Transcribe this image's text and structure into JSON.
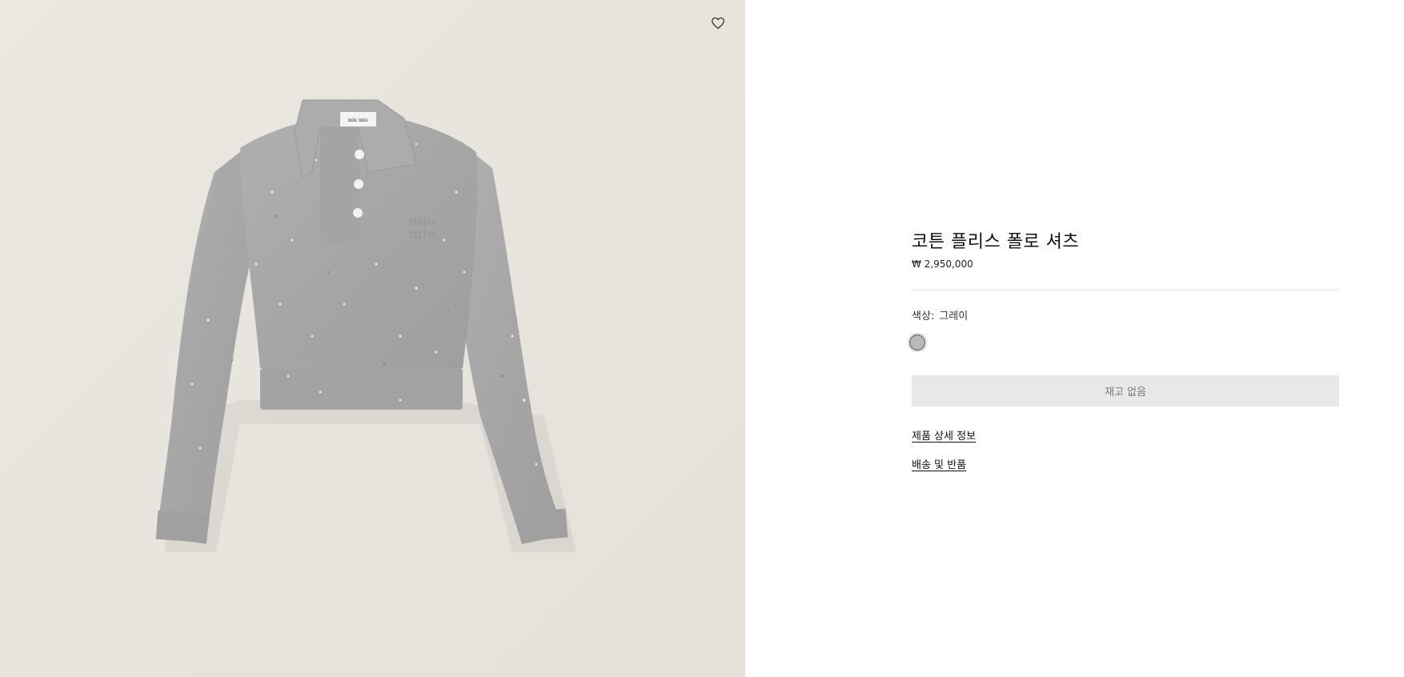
{
  "product": {
    "title": "코튼 플리스 폴로 셔츠",
    "price": "₩ 2,950,000",
    "color_label": "색상:",
    "color_value": "그레이",
    "swatch_color": "#b8b8b8",
    "stock_button_label": "재고 없음",
    "details_link": "제품 상세 정보",
    "shipping_link": "배송 및 반품",
    "image_alt_icon": "cropped-polo-sweatshirt-image",
    "garment_brand_label": "miu miu"
  },
  "icons": {
    "wishlist": "heart-icon"
  },
  "colors": {
    "image_background": "#e8e4de",
    "garment": "#a9a9a9",
    "disabled_button_bg": "#e8e8e8",
    "disabled_button_text": "#777777",
    "divider": "#e3e3e3"
  }
}
